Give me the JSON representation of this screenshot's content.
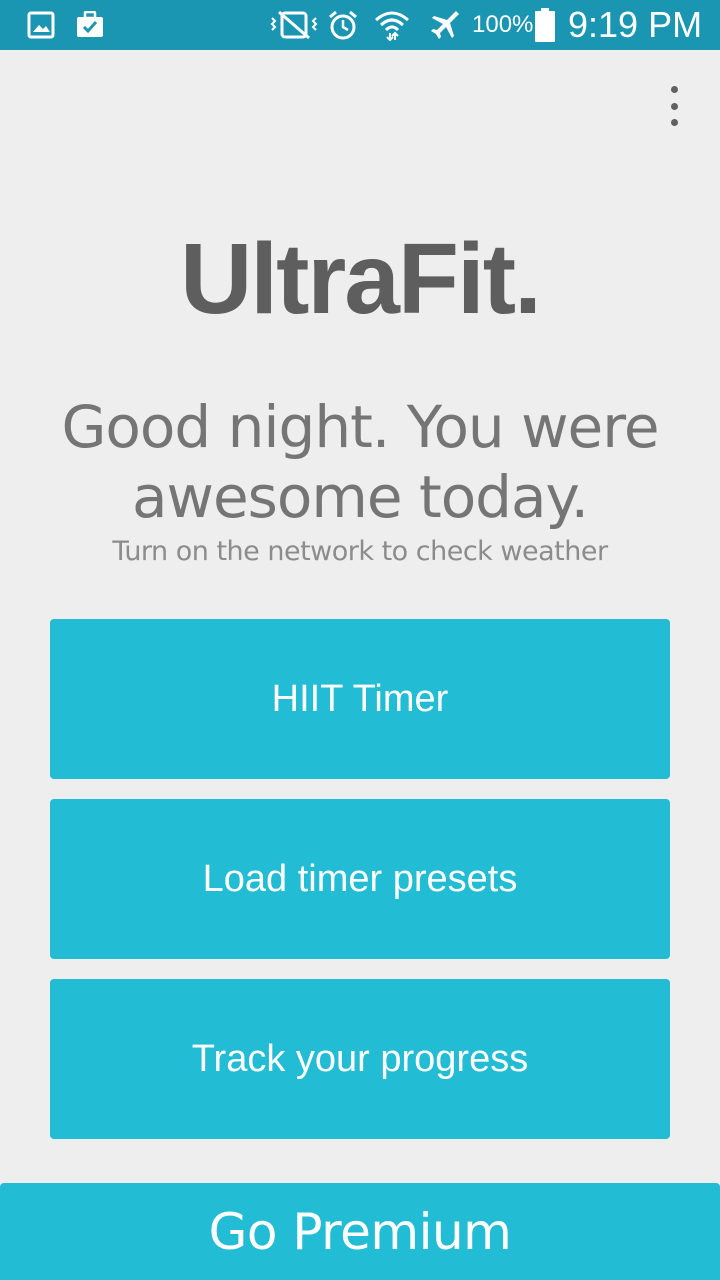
{
  "status_bar": {
    "battery": "100%",
    "time": "9:19 PM",
    "icons": [
      "gallery-icon",
      "task-check-icon",
      "vibrate-icon",
      "alarm-icon",
      "wifi-icon",
      "airplane-mode-icon",
      "battery-icon"
    ]
  },
  "header": {
    "app_title": "UltraFit.",
    "overflow_icon": "more-vert-icon"
  },
  "greeting": {
    "line1": "Good night. You were",
    "line2": "awesome today.",
    "weather_note": "Turn on the network to check weather"
  },
  "menu": {
    "hiit_timer": "HIIT Timer",
    "load_presets": "Load timer presets",
    "track_progress": "Track your progress"
  },
  "premium": {
    "label": "Go Premium"
  },
  "colors": {
    "status_bar": "#1a96b3",
    "accent": "#22bcd4",
    "background": "#eeeeee",
    "title_text": "#5e5e5e"
  }
}
